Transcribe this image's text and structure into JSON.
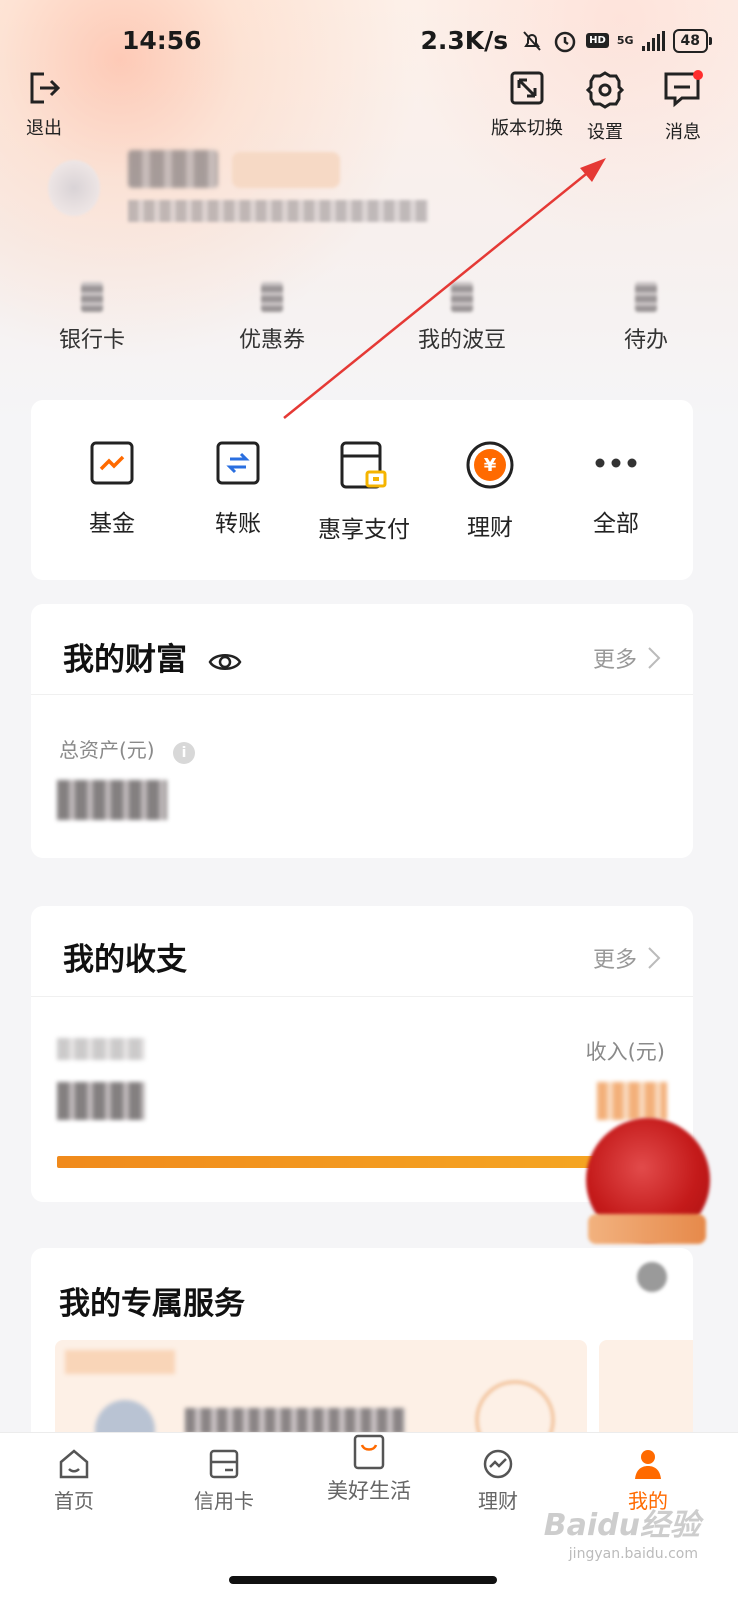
{
  "status_bar": {
    "time": "14:56",
    "net_speed": "2.3K/s",
    "hd": "HD",
    "network": "5G",
    "battery": "48"
  },
  "header": {
    "logout_label": "退出",
    "version_switch_label": "版本切换",
    "settings_label": "设置",
    "messages_label": "消息"
  },
  "stats": [
    {
      "label": "银行卡"
    },
    {
      "label": "优惠券"
    },
    {
      "label": "我的波豆"
    },
    {
      "label": "待办"
    }
  ],
  "quick_actions": [
    {
      "label": "基金",
      "icon": "fund-chart-icon"
    },
    {
      "label": "转账",
      "icon": "transfer-icon"
    },
    {
      "label": "惠享支付",
      "icon": "payment-card-icon"
    },
    {
      "label": "理财",
      "icon": "yuan-coin-icon"
    },
    {
      "label": "全部",
      "icon": "more-dots-icon"
    }
  ],
  "wealth": {
    "title": "我的财富",
    "more": "更多",
    "total_assets_label": "总资产(元)"
  },
  "income_expense": {
    "title": "我的收支",
    "more": "更多",
    "income_label": "收入(元)"
  },
  "exclusive": {
    "title": "我的专属服务"
  },
  "tabs": [
    {
      "label": "首页",
      "icon": "home-icon"
    },
    {
      "label": "信用卡",
      "icon": "credit-card-icon"
    },
    {
      "label": "美好生活",
      "icon": "shopping-bag-icon"
    },
    {
      "label": "理财",
      "icon": "finance-icon"
    },
    {
      "label": "我的",
      "icon": "profile-icon"
    }
  ],
  "watermark": {
    "brand": "Baidu经验",
    "url": "jingyan.baidu.com"
  },
  "colors": {
    "accent": "#ff6a00",
    "arrow": "#e53935",
    "progress": "#f08a1c"
  }
}
